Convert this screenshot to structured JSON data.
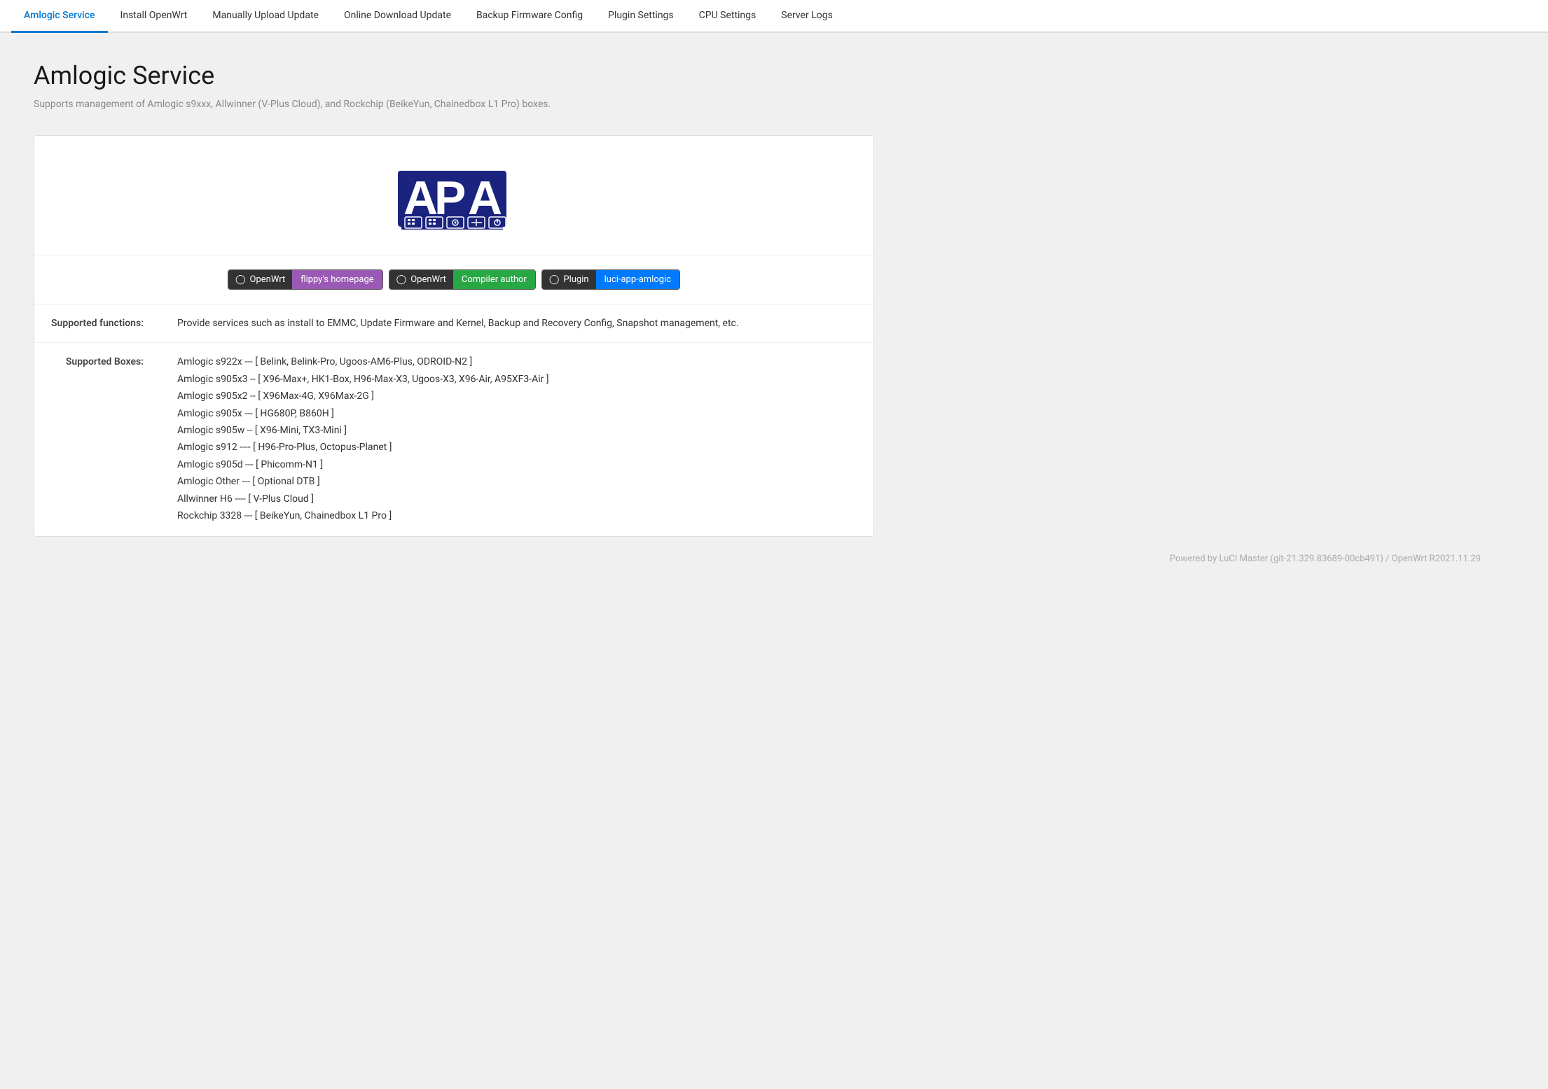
{
  "nav": {
    "items": [
      {
        "label": "Amlogic Service",
        "active": true
      },
      {
        "label": "Install OpenWrt",
        "active": false
      },
      {
        "label": "Manually Upload Update",
        "active": false
      },
      {
        "label": "Online Download Update",
        "active": false
      },
      {
        "label": "Backup Firmware Config",
        "active": false
      },
      {
        "label": "Plugin Settings",
        "active": false
      },
      {
        "label": "CPU Settings",
        "active": false
      },
      {
        "label": "Server Logs",
        "active": false
      }
    ]
  },
  "page": {
    "title": "Amlogic Service",
    "subtitle": "Supports management of Amlogic s9xxx, Allwinner (V-Plus Cloud), and Rockchip (BeikeYun, Chainedbox L1 Pro) boxes."
  },
  "card": {
    "buttons": [
      {
        "github_label": "OpenWrt",
        "color_label": "flippy's homepage",
        "color": "#9b59b6"
      },
      {
        "github_label": "OpenWrt",
        "color_label": "Compiler author",
        "color": "#28a745"
      },
      {
        "github_label": "Plugin",
        "color_label": "luci-app-amlogic",
        "color": "#007bff"
      }
    ],
    "supported_functions_label": "Supported functions:",
    "supported_functions_value": "Provide services such as install to EMMC, Update Firmware and Kernel, Backup and Recovery Config, Snapshot management, etc.",
    "supported_boxes_label": "Supported Boxes:",
    "supported_boxes": [
      "Amlogic s922x --- [ Belink, Belink-Pro, Ugoos-AM6-Plus, ODROID-N2 ]",
      "Amlogic s905x3 -- [ X96-Max+, HK1-Box, H96-Max-X3, Ugoos-X3, X96-Air, A95XF3-Air ]",
      "Amlogic s905x2 -- [ X96Max-4G, X96Max-2G ]",
      "Amlogic s905x --- [ HG680P, B860H ]",
      "Amlogic s905w -- [ X96-Mini, TX3-Mini ]",
      "Amlogic s912 ---- [ H96-Pro-Plus, Octopus-Planet ]",
      "Amlogic s905d --- [ Phicomm-N1 ]",
      "Amlogic Other --- [ Optional DTB ]",
      "Allwinner H6 ---- [ V-Plus Cloud ]",
      "Rockchip 3328 --- [ BeikeYun, Chainedbox L1 Pro ]"
    ]
  },
  "footer": {
    "text": "Powered by LuCI Master (git-21.329.83689-00cb491) / OpenWrt R2021.11.29"
  }
}
